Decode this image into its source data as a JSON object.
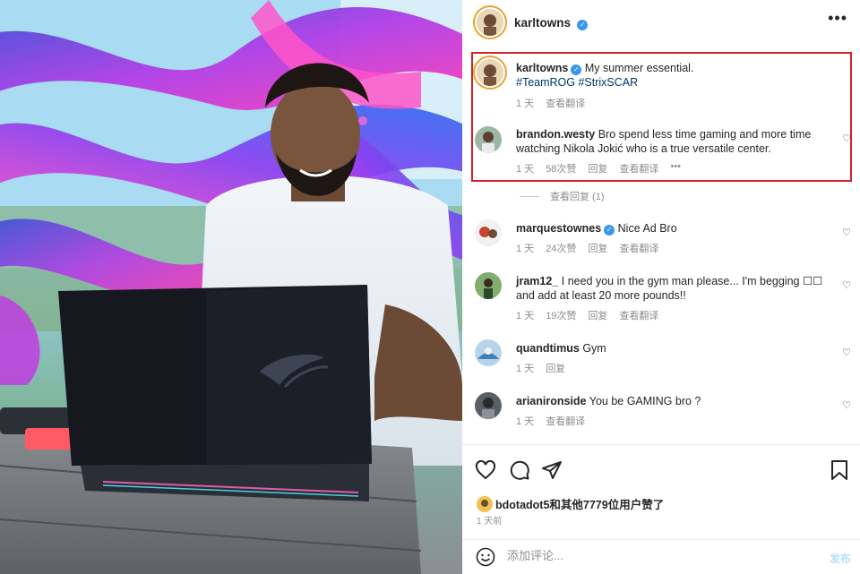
{
  "post_author": {
    "username": "karltowns",
    "verified_icon": "verified-badge-icon",
    "more_icon": "more-options-icon"
  },
  "caption": {
    "username": "karltowns",
    "text": "My summer essential.",
    "hashtags": "#TeamROG #StrixSCAR",
    "age": "1 天",
    "translate": "查看翻译"
  },
  "comments": [
    {
      "username": "brandon.westy",
      "text": "Bro spend less time gaming and more time watching Nikola Jokić who is a true versatile center.",
      "age": "1 天",
      "likes": "58次赞",
      "reply": "回复",
      "translate": "查看翻译",
      "more": "•••"
    },
    {
      "username": "marquestownes",
      "verified": true,
      "text": "Nice Ad Bro",
      "age": "1 天",
      "likes": "24次赞",
      "reply": "回复",
      "translate": "查看翻译"
    },
    {
      "username": "jram12_",
      "text": "I need you in the gym man please... I'm begging ☐☐ and add at least 20 more pounds!!",
      "age": "1 天",
      "likes": "19次赞",
      "reply": "回复",
      "translate": "查看翻译"
    },
    {
      "username": "quandtimus",
      "text": "Gym",
      "age": "1 天",
      "reply": "回复"
    },
    {
      "username": "arianironside",
      "text": "You be GAMING bro ?",
      "age": "1 天",
      "translate": "查看翻译"
    }
  ],
  "view_replies": "查看回复 (1)",
  "likes_summary": "bdotadot5和其他7779位用户赞了",
  "post_age": "1 天前",
  "add_comment": {
    "placeholder": "添加评论...",
    "post_label": "发布"
  },
  "colors": {
    "highlight_border": "#d5202a",
    "link": "#00376b",
    "verified": "#3897f0",
    "muted": "#8e8e8e"
  }
}
